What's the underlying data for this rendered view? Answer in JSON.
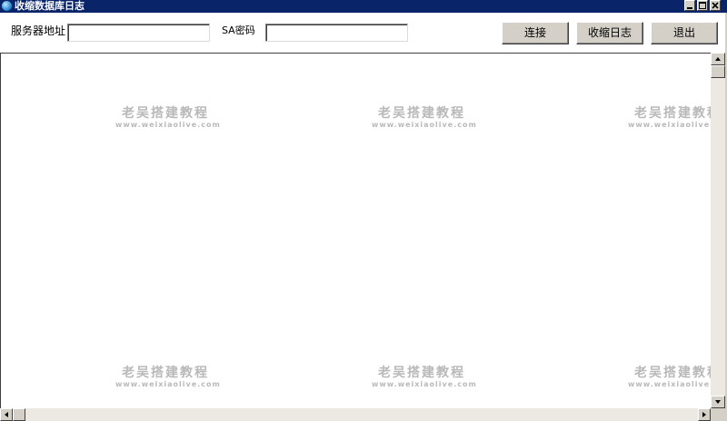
{
  "window": {
    "title": "收缩数据库日志",
    "icon": "app-globe-icon"
  },
  "form": {
    "server_label": "服务器地址",
    "server_value": "",
    "sa_label": "SA密码",
    "sa_value": ""
  },
  "buttons": {
    "connect": "连接",
    "shrink_log": "收缩日志",
    "exit": "退出"
  },
  "log": {
    "content": ""
  },
  "watermark": {
    "title": "老吴搭建教程",
    "url": "www.weixiaolive.com"
  }
}
